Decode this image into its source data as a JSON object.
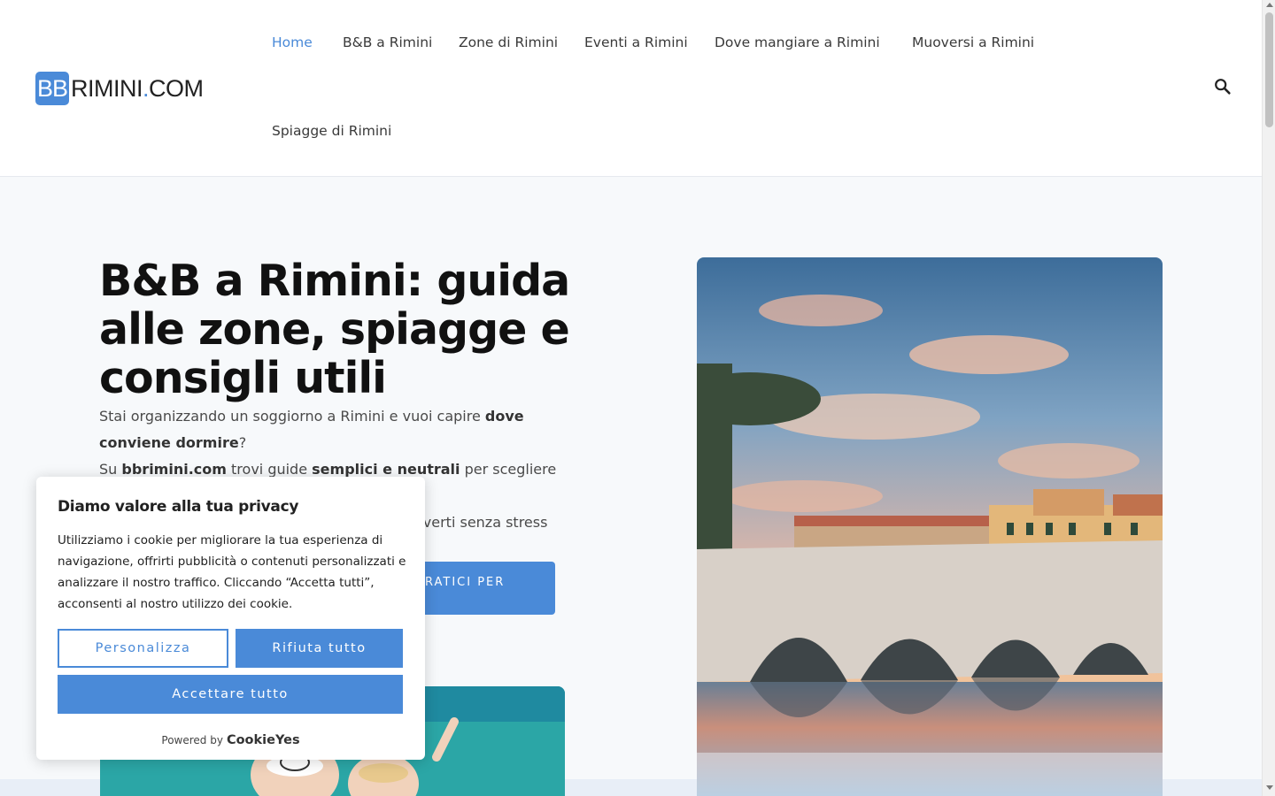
{
  "header": {
    "logo": {
      "bb": "BB",
      "rest": "RIMINI",
      "dot": ".",
      "com": "COM"
    },
    "nav": [
      {
        "label": "Home",
        "active": true
      },
      {
        "label": "B&B a Rimini"
      },
      {
        "label": "Zone di Rimini"
      },
      {
        "label": "Eventi a Rimini"
      },
      {
        "label": "Dove mangiare a Rimini"
      },
      {
        "label": "Muoversi a Rimini"
      },
      {
        "label": "Spiagge di Rimini"
      }
    ],
    "search_icon": "search-icon"
  },
  "hero": {
    "title": "B&B a Rimini: guida alle zone, spiagge e consigli utili",
    "p1_a": "Stai organizzando un soggiorno a Rimini e vuoi capire ",
    "p1_b": "dove conviene dormire",
    "p1_c": "?",
    "p2_a": "Su ",
    "p2_b": "bbrimini.com",
    "p2_c": " trovi guide ",
    "p2_d": "semplici e neutrali",
    "p2_e": " per scegliere la",
    "p3": "overti senza stress",
    "cta_label": "RATICI PER"
  },
  "cookie": {
    "title": "Diamo valore alla tua privacy",
    "text": "Utilizziamo i cookie per migliorare la tua esperienza di navigazione, offrirti pubblicità o contenuti personalizzati e analizzare il nostro traffico. Cliccando “Accetta tutti”, acconsenti al nostro utilizzo dei cookie.",
    "customize": "Personalizza",
    "reject": "Rifiuta tutto",
    "accept": "Accettare tutto",
    "powered_by": "Powered by",
    "brand": "CookieYes"
  },
  "colors": {
    "accent": "#4a8ad8"
  }
}
